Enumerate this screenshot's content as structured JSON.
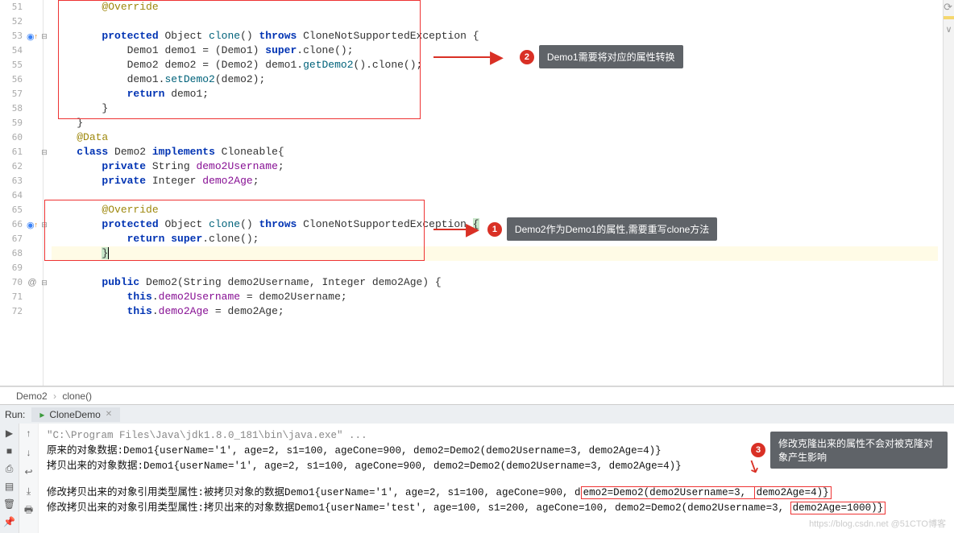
{
  "gutter": {
    "lines": [
      51,
      52,
      53,
      54,
      55,
      56,
      57,
      58,
      59,
      60,
      61,
      62,
      63,
      64,
      65,
      66,
      67,
      68,
      69,
      70,
      71,
      72
    ],
    "icons": {
      "53": "⬤ ↑",
      "66": "⬤ ↑",
      "70": "@"
    }
  },
  "code": {
    "l51": {
      "indent": "        ",
      "t1": "@Override"
    },
    "l52": {
      "indent": "",
      "t1": ""
    },
    "l53": {
      "indent": "        ",
      "kw1": "protected",
      "sp1": " ",
      "ty": "Object",
      "sp2": " ",
      "me": "clone",
      "pr": "() ",
      "kw2": "throws",
      "sp3": " ",
      "ex": "CloneNotSupportedException {",
      "rest": ""
    },
    "l54": {
      "indent": "            ",
      "ty1": "Demo1",
      "sp1": " demo1 = (",
      "ty2": "Demo1",
      "sp2": ") ",
      "kw": "super",
      "t": ".clone();"
    },
    "l55": {
      "indent": "            ",
      "ty1": "Demo2",
      "sp1": " demo2 = (",
      "ty2": "Demo2",
      "sp2": ") demo1.",
      "m": "getDemo2",
      "t": "().clone();"
    },
    "l56": {
      "indent": "            ",
      "t": "demo1.",
      "m": "setDemo2",
      "t2": "(demo2);"
    },
    "l57": {
      "indent": "            ",
      "kw": "return",
      "t": " demo1;"
    },
    "l58": {
      "indent": "        ",
      "t": "}"
    },
    "l59": {
      "indent": "    ",
      "t": "}"
    },
    "l60": {
      "indent": "    ",
      "an": "@Data"
    },
    "l61": {
      "indent": "    ",
      "kw1": "class",
      "sp": " ",
      "ty": "Demo2 ",
      "kw2": "implements",
      "t": " Cloneable{"
    },
    "l62": {
      "indent": "        ",
      "kw": "private",
      "sp": " ",
      "ty": "String ",
      "f": "demo2Username",
      "t": ";"
    },
    "l63": {
      "indent": "        ",
      "kw": "private",
      "sp": " ",
      "ty": "Integer ",
      "f": "demo2Age",
      "t": ";"
    },
    "l65": {
      "indent": "        ",
      "an": "@Override"
    },
    "l66": {
      "indent": "        ",
      "kw1": "protected",
      "sp1": " ",
      "ty": "Object",
      "sp2": " ",
      "me": "clone",
      "pr": "() ",
      "kw2": "throws",
      "sp3": " ",
      "ex": "CloneNotSupportedException ",
      "br": "{"
    },
    "l67": {
      "indent": "            ",
      "kw1": "return",
      "sp": " ",
      "kw2": "super",
      "t": ".clone();"
    },
    "l68": {
      "indent": "        ",
      "br": "}"
    },
    "l70": {
      "indent": "        ",
      "kw": "public",
      "t": " Demo2(String demo2Username, Integer demo2Age) {"
    },
    "l71": {
      "indent": "            ",
      "kw": "this",
      "t": ".",
      "f": "demo2Username",
      "t2": " = demo2Username;"
    },
    "l72": {
      "indent": "            ",
      "kw": "this",
      "t": ".",
      "f": "demo2Age",
      "t2": " = demo2Age;"
    }
  },
  "callouts": {
    "c1": {
      "num": "1",
      "text": "Demo2作为Demo1的属性,需要重写clone方法"
    },
    "c2": {
      "num": "2",
      "text": "Demo1需要将对应的属性转换"
    },
    "c3": {
      "num": "3",
      "text": "修改克隆出来的属性不会对被克隆对象产生影响"
    }
  },
  "breadcrumb": {
    "a": "Demo2",
    "b": "clone()"
  },
  "run": {
    "label": "Run:",
    "tab": "CloneDemo"
  },
  "console": {
    "l0": "\"C:\\Program Files\\Java\\jdk1.8.0_181\\bin\\java.exe\" ...",
    "l1": "原来的对象数据:Demo1{userName='1', age=2, s1=100, ageCone=900, demo2=Demo2(demo2Username=3, demo2Age=4)}",
    "l2": "拷贝出来的对象数据:Demo1{userName='1', age=2, s1=100, ageCone=900, demo2=Demo2(demo2Username=3, demo2Age=4)}",
    "l3a": "修改拷贝出来的对象引用类型属性:被拷贝对象的数据Demo1{userName='1', age=2, s1=100, ageCone=900, d",
    "l3b": "emo2=Demo2(demo2Username=3, ",
    "l3c": "demo2Age=4)}",
    "l4a": "修改拷贝出来的对象引用类型属性:拷贝出来的对象数据Demo1{userName='test', age=100, s1=200, ageCone=100, demo2=Demo2(demo2Username=3, ",
    "l4b": "demo2Age=1000)}"
  },
  "watermark": "https://blog.csdn.net @51CTO博客"
}
